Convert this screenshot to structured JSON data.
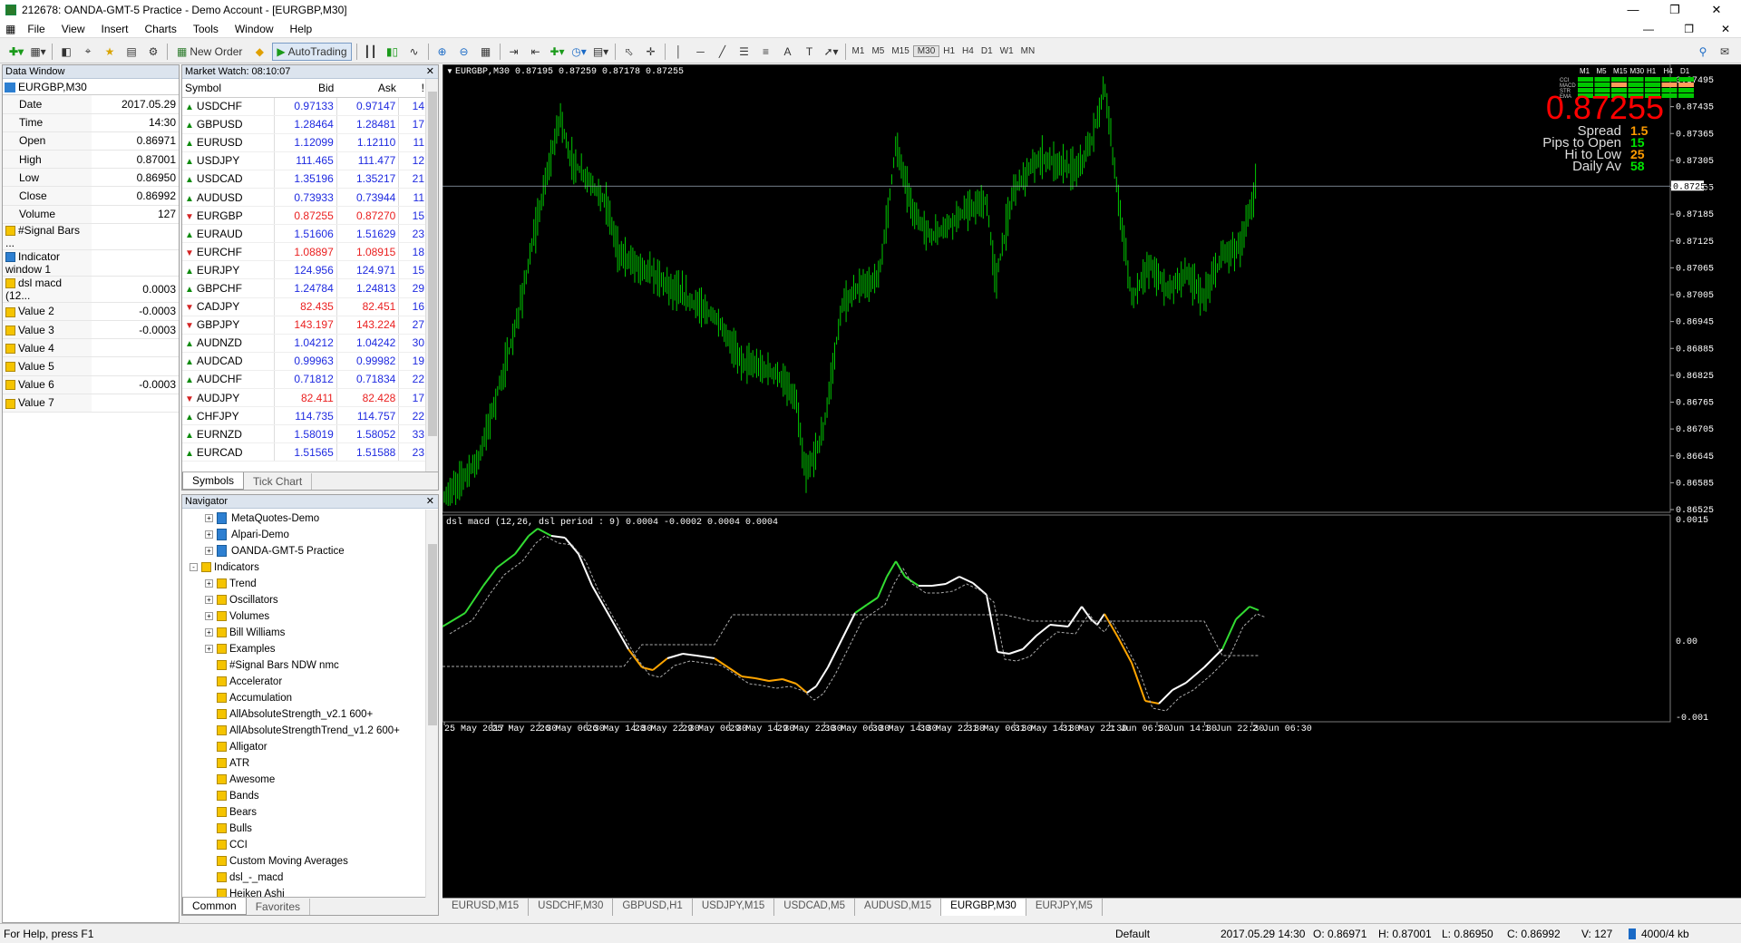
{
  "window": {
    "title": "212678: OANDA-GMT-5 Practice - Demo Account - [EURGBP,M30]"
  },
  "menu": [
    "File",
    "View",
    "Insert",
    "Charts",
    "Tools",
    "Window",
    "Help"
  ],
  "toolbar": {
    "new_order": "New Order",
    "autotrading": "AutoTrading",
    "timeframes": [
      "M1",
      "M5",
      "M15",
      "M30",
      "H1",
      "H4",
      "D1",
      "W1",
      "MN"
    ],
    "active_tf": "M30"
  },
  "data_window": {
    "title": "Data Window",
    "symbol": "EURGBP,M30",
    "rows": [
      [
        "Date",
        "2017.05.29"
      ],
      [
        "Time",
        "14:30"
      ],
      [
        "Open",
        "0.86971"
      ],
      [
        "High",
        "0.87001"
      ],
      [
        "Low",
        "0.86950"
      ],
      [
        "Close",
        "0.86992"
      ],
      [
        "Volume",
        "127"
      ]
    ],
    "indicators": [
      [
        "#Signal Bars ...",
        ""
      ],
      [
        "Indicator window 1",
        ""
      ],
      [
        "dsl macd (12...",
        "0.0003"
      ],
      [
        "Value 2",
        "-0.0003"
      ],
      [
        "Value 3",
        "-0.0003"
      ],
      [
        "Value 4",
        ""
      ],
      [
        "Value 5",
        ""
      ],
      [
        "Value 6",
        "-0.0003"
      ],
      [
        "Value 7",
        ""
      ]
    ]
  },
  "market_watch": {
    "title": "Market Watch: 08:10:07",
    "headers": [
      "Symbol",
      "Bid",
      "Ask",
      "!"
    ],
    "rows": [
      [
        "USDCHF",
        "0.97133",
        "0.97147",
        "14",
        "up"
      ],
      [
        "GBPUSD",
        "1.28464",
        "1.28481",
        "17",
        "up"
      ],
      [
        "EURUSD",
        "1.12099",
        "1.12110",
        "11",
        "up"
      ],
      [
        "USDJPY",
        "111.465",
        "111.477",
        "12",
        "up"
      ],
      [
        "USDCAD",
        "1.35196",
        "1.35217",
        "21",
        "up"
      ],
      [
        "AUDUSD",
        "0.73933",
        "0.73944",
        "11",
        "up"
      ],
      [
        "EURGBP",
        "0.87255",
        "0.87270",
        "15",
        "dn"
      ],
      [
        "EURAUD",
        "1.51606",
        "1.51629",
        "23",
        "up"
      ],
      [
        "EURCHF",
        "1.08897",
        "1.08915",
        "18",
        "dn"
      ],
      [
        "EURJPY",
        "124.956",
        "124.971",
        "15",
        "up"
      ],
      [
        "GBPCHF",
        "1.24784",
        "1.24813",
        "29",
        "up"
      ],
      [
        "CADJPY",
        "82.435",
        "82.451",
        "16",
        "dn"
      ],
      [
        "GBPJPY",
        "143.197",
        "143.224",
        "27",
        "dn"
      ],
      [
        "AUDNZD",
        "1.04212",
        "1.04242",
        "30",
        "up"
      ],
      [
        "AUDCAD",
        "0.99963",
        "0.99982",
        "19",
        "up"
      ],
      [
        "AUDCHF",
        "0.71812",
        "0.71834",
        "22",
        "up"
      ],
      [
        "AUDJPY",
        "82.411",
        "82.428",
        "17",
        "dn"
      ],
      [
        "CHFJPY",
        "114.735",
        "114.757",
        "22",
        "up"
      ],
      [
        "EURNZD",
        "1.58019",
        "1.58052",
        "33",
        "up"
      ],
      [
        "EURCAD",
        "1.51565",
        "1.51588",
        "23",
        "up"
      ]
    ],
    "tabs": [
      "Symbols",
      "Tick Chart"
    ]
  },
  "navigator": {
    "title": "Navigator",
    "accounts": [
      "MetaQuotes-Demo",
      "Alpari-Demo",
      "OANDA-GMT-5 Practice"
    ],
    "indicators_label": "Indicators",
    "folders": [
      "Trend",
      "Oscillators",
      "Volumes",
      "Bill Williams",
      "Examples"
    ],
    "items": [
      "#Signal Bars NDW nmc",
      "Accelerator",
      "Accumulation",
      "AllAbsoluteStrength_v2.1 600+",
      "AllAbsoluteStrengthTrend_v1.2 600+",
      "Alligator",
      "ATR",
      "Awesome",
      "Bands",
      "Bears",
      "Bulls",
      "CCI",
      "Custom Moving Averages",
      "dsl_-_macd",
      "Heiken Ashi"
    ],
    "tabs": [
      "Common",
      "Favorites"
    ]
  },
  "chart": {
    "header": "EURGBP,M30  0.87195 0.87259 0.87178 0.87255",
    "big_price": "0.87255",
    "panel_tfs": [
      "M1",
      "M5",
      "M15",
      "M30",
      "H1",
      "H4",
      "D1"
    ],
    "panel_rows": [
      "CCI",
      "MACD",
      "STR",
      "EMA"
    ],
    "stats": [
      [
        "Spread",
        "1.5",
        "#ff9c00"
      ],
      [
        "Pips to Open",
        "15",
        "#00e600"
      ],
      [
        "Hi to Low",
        "25",
        "#ff9c00"
      ],
      [
        "Daily Av",
        "58",
        "#00e600"
      ]
    ],
    "price_ticks": [
      "0.87495",
      "0.87435",
      "0.87365",
      "0.87305",
      "0.87255",
      "0.87185",
      "0.87125",
      "0.87065",
      "0.87005",
      "0.86945",
      "0.86885",
      "0.86825",
      "0.86765",
      "0.86705",
      "0.86645",
      "0.86585",
      "0.86525"
    ],
    "current_tag": "0.87255",
    "macd_header": "dsl macd (12,26, dsl period : 9) 0.0004 -0.0002 0.0004 0.0004",
    "macd_ticks": [
      "0.0015",
      "0.00",
      "-0.001"
    ],
    "time_ticks": [
      "25 May 2017",
      "25 May 22:30",
      "26 May 06:30",
      "26 May 14:30",
      "28 May 22:30",
      "29 May 06:30",
      "29 May 14:30",
      "29 May 22:30",
      "30 May 06:30",
      "30 May 14:30",
      "30 May 22:30",
      "31 May 06:30",
      "31 May 14:30",
      "31 May 22:30",
      "1 Jun 06:30",
      "1 Jun 14:30",
      "1 Jun 22:30",
      "2 Jun 06:30"
    ],
    "colors": {
      "bull": "#00c800",
      "macd_up": "#32dc32",
      "macd_down": "#ffa500",
      "macd_flat": "#ffffff"
    }
  },
  "chart_tabs": [
    "EURUSD,M15",
    "USDCHF,M30",
    "GBPUSD,H1",
    "USDJPY,M15",
    "USDCAD,M5",
    "AUDUSD,M15",
    "EURGBP,M30",
    "EURJPY,M5"
  ],
  "active_chart_tab": "EURGBP,M30",
  "status": {
    "help": "For Help, press F1",
    "profile": "Default",
    "datetime": "2017.05.29 14:30",
    "open": "O: 0.86971",
    "high": "H: 0.87001",
    "low": "L: 0.86950",
    "close": "C: 0.86992",
    "volume": "V: 127",
    "traffic": "4000/4 kb"
  }
}
